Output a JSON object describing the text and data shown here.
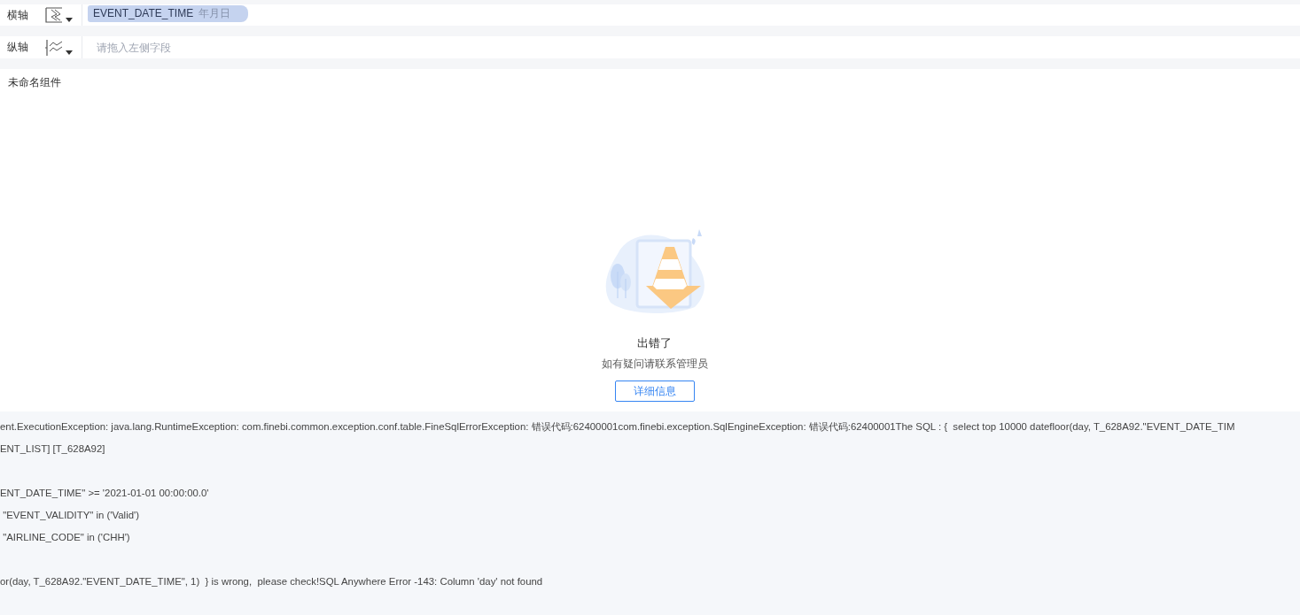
{
  "axes": [
    {
      "label": "横轴",
      "field": {
        "name": "EVENT_DATE_TIME",
        "suffix": "年月日"
      }
    },
    {
      "label": "纵轴",
      "placeholder": "请拖入左侧字段"
    }
  ],
  "widget": {
    "title": "未命名组件",
    "error_title": "出错了",
    "error_hint": "如有疑问请联系管理员",
    "details_button": "详细信息"
  },
  "error_log": [
    {
      "lines": [
        "ent.ExecutionException: java.lang.RuntimeException: com.finebi.common.exception.conf.table.FineSqlErrorException: 错误代码:62400001com.finebi.exception.SqlEngineException: 错误代码:62400001The SQL : {  select top 10000 datefloor(day, T_628A92.\"EVENT_DATE_TIM",
        "ENT_LIST] [T_628A92]"
      ]
    },
    {
      "lines": [
        "ENT_DATE_TIME\" >= '2021-01-01 00:00:00.0'",
        " \"EVENT_VALIDITY\" in ('Valid')",
        " \"AIRLINE_CODE\" in ('CHH')"
      ]
    },
    {
      "lines": [
        "or(day, T_628A92.\"EVENT_DATE_TIME\", 1)  } is wrong,  please check!SQL Anywhere Error -143: Column 'day' not found"
      ]
    }
  ]
}
